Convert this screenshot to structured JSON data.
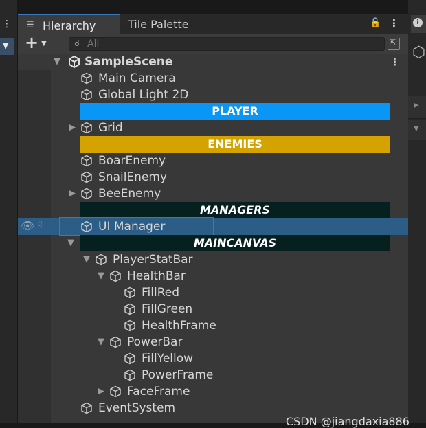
{
  "tabs": {
    "hierarchy_label": "Hierarchy",
    "tile_palette_label": "Tile Palette"
  },
  "toolbar": {
    "add_symbol": "+",
    "search_placeholder": "All"
  },
  "scene": {
    "name": "SampleScene"
  },
  "items": [
    {
      "label": "Main Camera",
      "depth": 0
    },
    {
      "label": "Global Light 2D",
      "depth": 0
    },
    {
      "label": "PLAYER",
      "type": "header",
      "color": "#0a96f5",
      "text_color": "#ffffff",
      "italic": false
    },
    {
      "label": "Grid",
      "depth": 0,
      "collapsed": true
    },
    {
      "label": "ENEMIES",
      "type": "header",
      "color": "#d4a300",
      "text_color": "#ffffff",
      "italic": false
    },
    {
      "label": "BoarEnemy",
      "depth": 0
    },
    {
      "label": "SnailEnemy",
      "depth": 0
    },
    {
      "label": "BeeEnemy",
      "depth": 0,
      "collapsed": true
    },
    {
      "label": "MANAGERS",
      "type": "header",
      "color": "#062020",
      "text_color": "#ffffff",
      "italic": true
    },
    {
      "label": "UI Manager",
      "depth": 0,
      "selected": true
    },
    {
      "label": "MAINCANVAS",
      "type": "header",
      "color": "#062020",
      "text_color": "#ffffff",
      "italic": true
    },
    {
      "label": "PlayerStatBar",
      "depth": 1,
      "expanded": true
    },
    {
      "label": "HealthBar",
      "depth": 2,
      "expanded": true
    },
    {
      "label": "FillRed",
      "depth": 3
    },
    {
      "label": "FillGreen",
      "depth": 3
    },
    {
      "label": "HealthFrame",
      "depth": 3
    },
    {
      "label": "PowerBar",
      "depth": 2,
      "expanded": true
    },
    {
      "label": "FillYellow",
      "depth": 3
    },
    {
      "label": "PowerFrame",
      "depth": 3
    },
    {
      "label": "FaceFrame",
      "depth": 2,
      "collapsed": true
    },
    {
      "label": "EventSystem",
      "depth": 0
    }
  ],
  "watermark": "CSDN @jiangdaxia886",
  "colors": {
    "accent": "#3a79bb",
    "selection": "#2c5d87",
    "highlight_border": "#e03c3c"
  }
}
